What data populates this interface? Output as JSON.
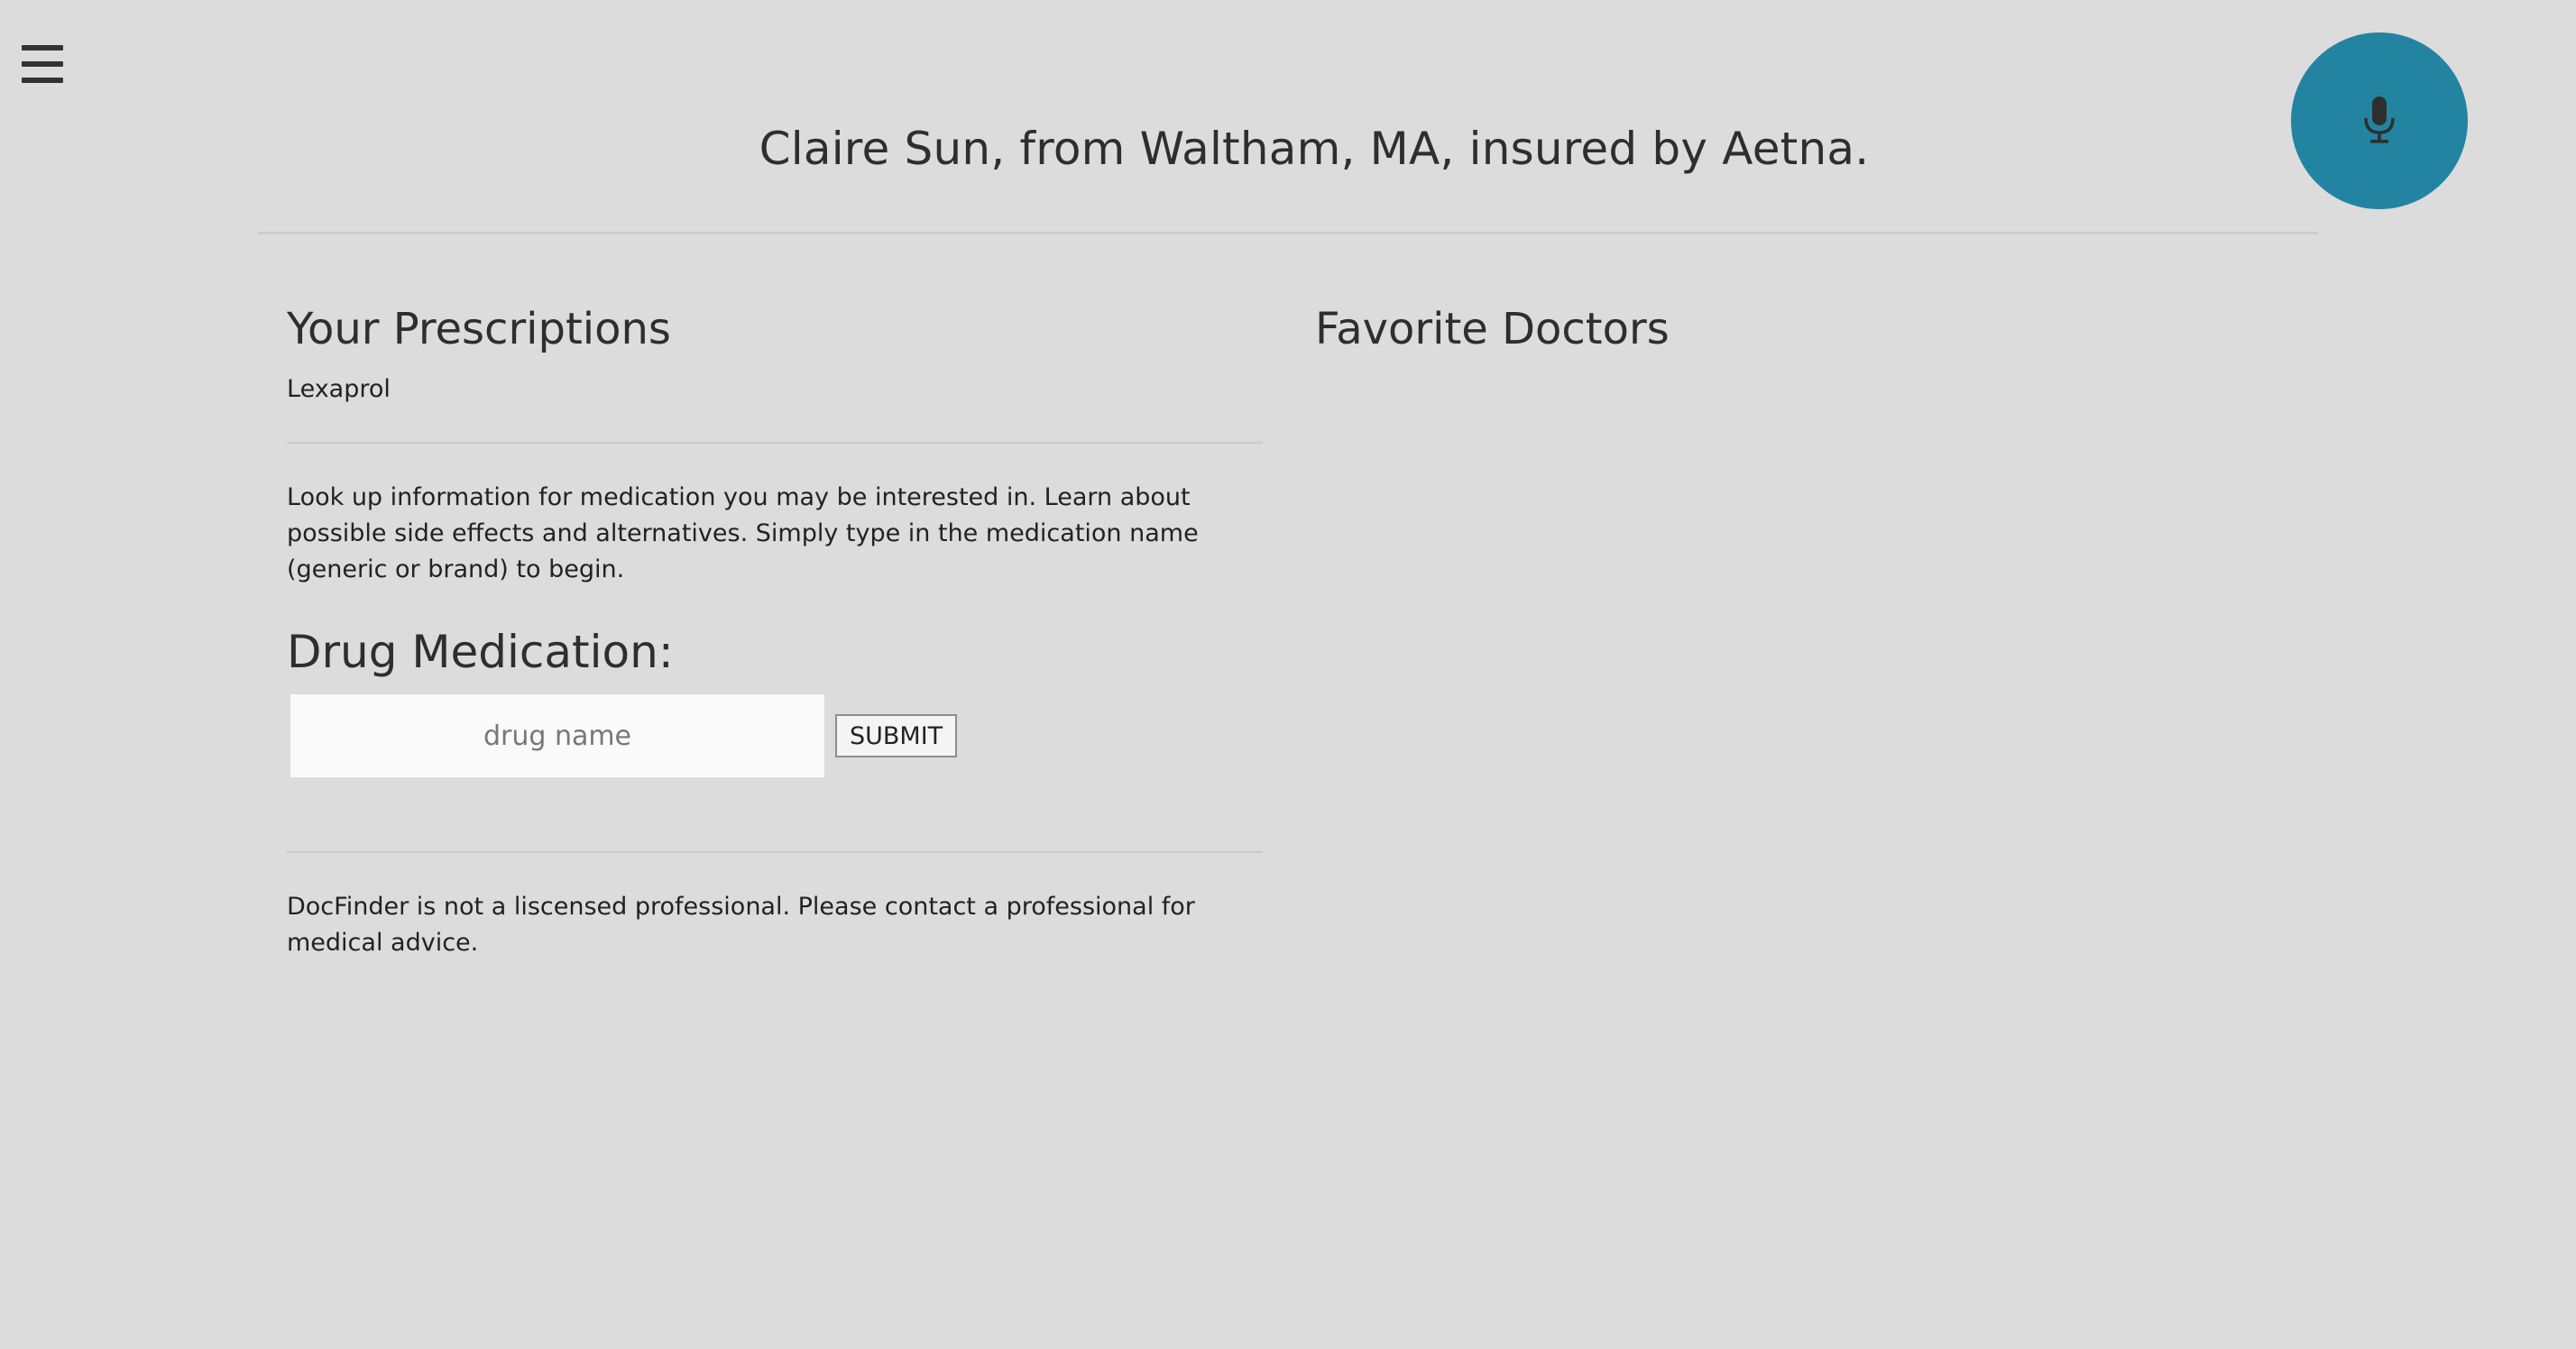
{
  "header": {
    "title": "Claire Sun, from Waltham, MA, insured by Aetna."
  },
  "prescriptions": {
    "heading": "Your Prescriptions",
    "items": [
      "Lexaprol"
    ]
  },
  "lookup": {
    "info": "Look up information for medication you may be interested in. Learn about possible side effects and alternatives. Simply type in the medication name (generic or brand) to begin.",
    "heading": "Drug Medication:",
    "input_placeholder": "drug name",
    "input_value": "",
    "submit_label": "SUBMIT"
  },
  "disclaimer": "DocFinder is not a liscensed professional. Please contact a professional for medical advice.",
  "favorites": {
    "heading": "Favorite Doctors"
  },
  "icons": {
    "menu": "hamburger-menu-icon",
    "mic": "microphone-icon"
  },
  "colors": {
    "background": "#dcdcdc",
    "mic_button": "#2384a1",
    "text": "#2e2e2e"
  }
}
